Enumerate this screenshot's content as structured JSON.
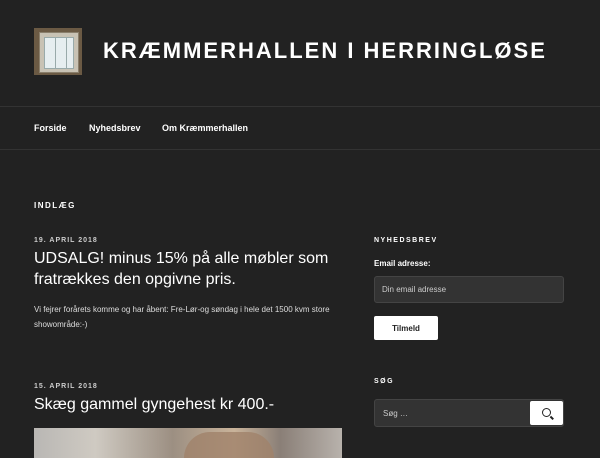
{
  "site": {
    "title": "KRÆMMERHALLEN I HERRINGLØSE"
  },
  "nav": {
    "items": [
      {
        "label": "Forside"
      },
      {
        "label": "Nyhedsbrev"
      },
      {
        "label": "Om Kræmmerhallen"
      }
    ]
  },
  "main": {
    "section_title": "INDLÆG",
    "posts": [
      {
        "date": "19. APRIL 2018",
        "title": "UDSALG! minus 15% på alle møbler som fratrækkes den opgivne pris.",
        "excerpt": "Vi fejrer forårets komme og har åbent: Fre-Lør-og søndag i hele det 1500 kvm store showområde:-)"
      },
      {
        "date": "15. APRIL 2018",
        "title": "Skæg gammel gyngehest kr 400.-"
      }
    ]
  },
  "sidebar": {
    "newsletter": {
      "title": "NYHEDSBREV",
      "label": "Email adresse:",
      "placeholder": "Din email adresse",
      "button": "Tilmeld"
    },
    "search": {
      "title": "SØG",
      "placeholder": "Søg …",
      "button_icon": "search-icon"
    }
  },
  "colors": {
    "background": "#222222",
    "text": "#ffffff",
    "input_background": "#333333"
  }
}
